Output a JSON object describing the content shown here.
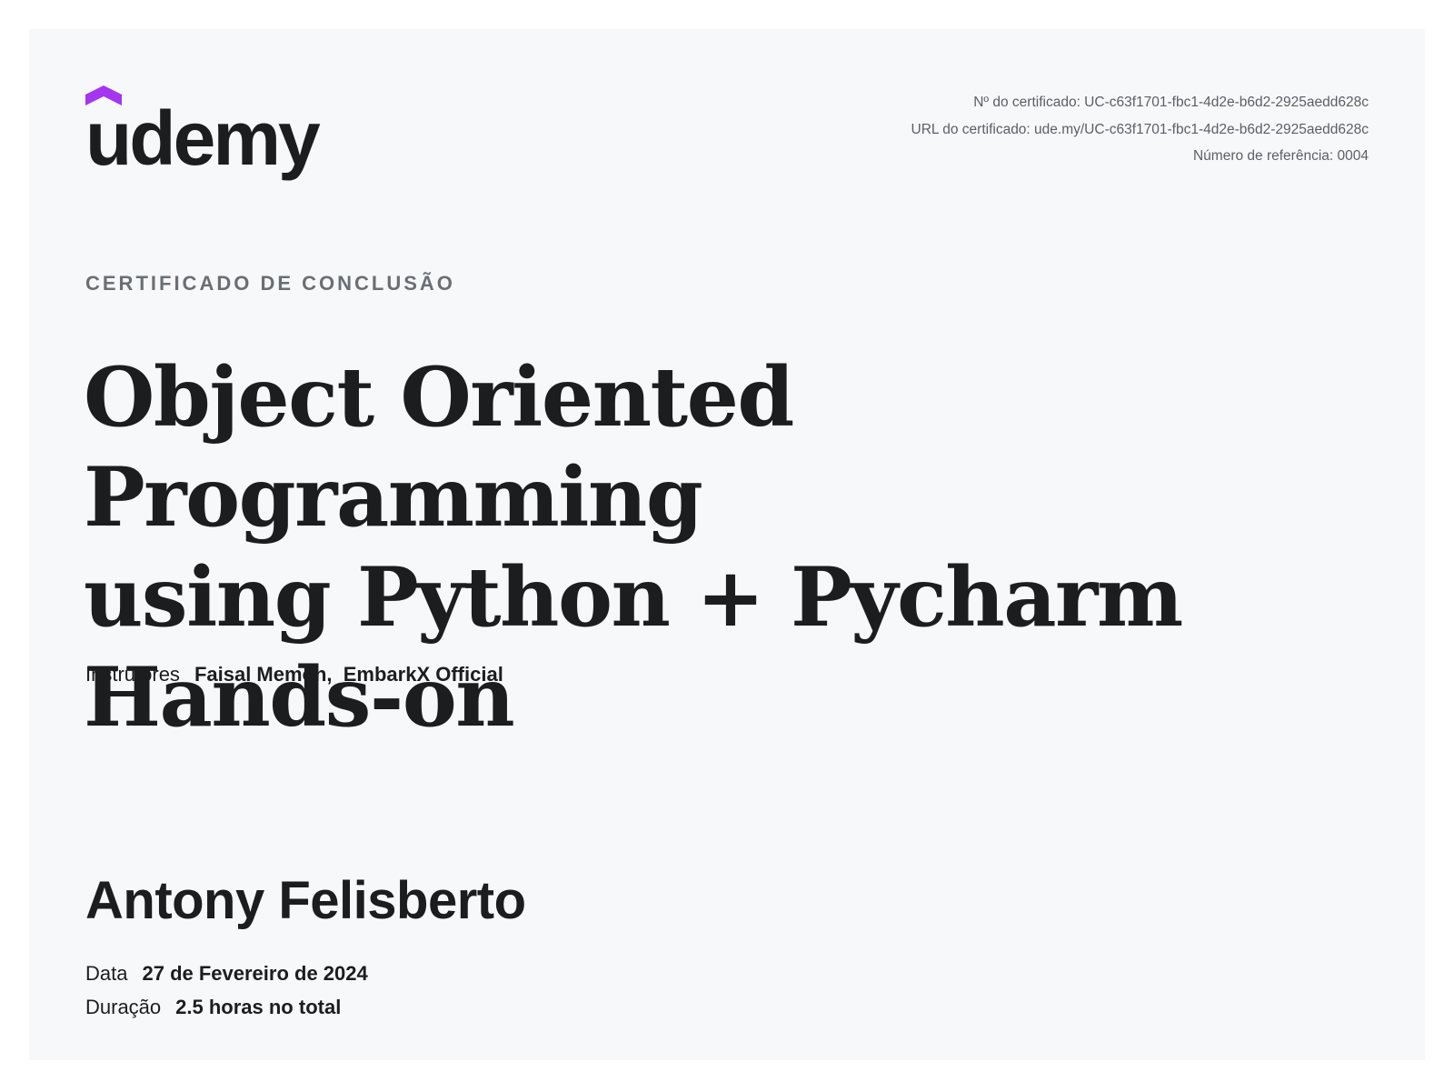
{
  "logo": {
    "text": "ûdemy",
    "mark_color": "#a435f0"
  },
  "certificate": {
    "number_line": "Nº do certificado: UC-c63f1701-fbc1-4d2e-b6d2-2925aedd628c",
    "url_line": "URL do certificado: ude.my/UC-c63f1701-fbc1-4d2e-b6d2-2925aedd628c",
    "reference_line": "Número de referência: 0004"
  },
  "kicker": "CERTIFICADO DE CONCLUSÃO",
  "course": {
    "title_lines": [
      "Object Oriented Programming",
      "using Python + Pycharm",
      "Hands-on"
    ]
  },
  "instructors": {
    "label": "Instrutores",
    "names": "Faisal Memon,  EmbarkX Official"
  },
  "student_name": "Antony Felisberto",
  "date": {
    "label": "Data",
    "value": "27 de Fevereiro de 2024"
  },
  "duration": {
    "label": "Duração",
    "value": "2.5 horas no total"
  }
}
